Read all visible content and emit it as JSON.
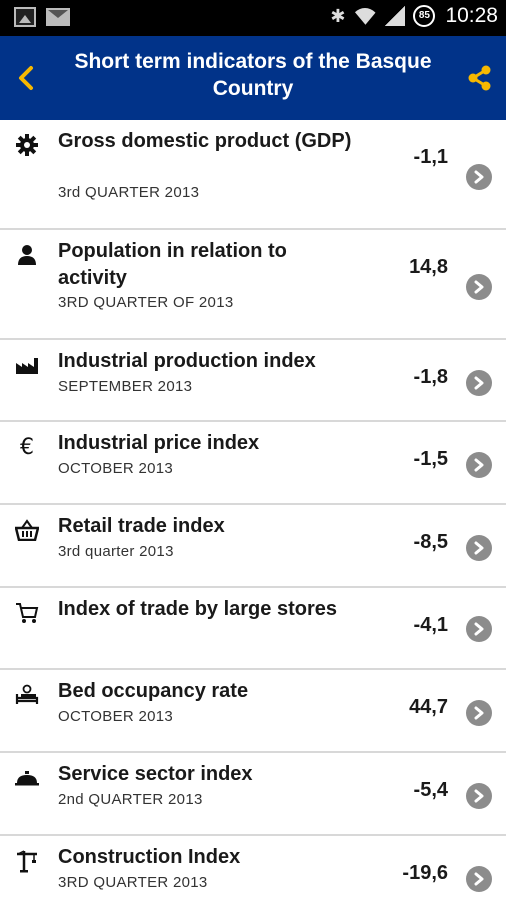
{
  "status_bar": {
    "time": "10:28",
    "battery_level": "85",
    "icons": [
      "gallery-icon",
      "email-icon",
      "bluetooth-icon",
      "wifi-icon",
      "signal-icon",
      "battery-icon"
    ]
  },
  "header": {
    "title": "Short term indicators of the Basque Country",
    "back_icon": "chevron-left-icon",
    "share_icon": "share-icon",
    "accent_color": "#f6b800",
    "background_color": "#013389"
  },
  "indicators": [
    {
      "icon": "gear-icon",
      "title": "Gross domestic product (GDP)",
      "period": "3rd QUARTER 2013",
      "value": "-1,1"
    },
    {
      "icon": "person-icon",
      "title": "Population in relation to activity",
      "period": "3RD QUARTER OF 2013",
      "value": "14,8"
    },
    {
      "icon": "factory-icon",
      "title": "Industrial production index",
      "period": "SEPTEMBER 2013",
      "value": "-1,8"
    },
    {
      "icon": "euro-icon",
      "title": "Industrial price index",
      "period": "OCTOBER 2013",
      "value": "-1,5"
    },
    {
      "icon": "basket-icon",
      "title": "Retail trade index",
      "period": "3rd quarter 2013",
      "value": "-8,5"
    },
    {
      "icon": "cart-icon",
      "title": "Index of trade by large stores",
      "period": "",
      "value": "-4,1"
    },
    {
      "icon": "bed-icon",
      "title": "Bed occupancy rate",
      "period": "OCTOBER 2013",
      "value": "44,7"
    },
    {
      "icon": "service-icon",
      "title": "Service sector index",
      "period": "2nd QUARTER 2013",
      "value": "-5,4"
    },
    {
      "icon": "crane-icon",
      "title": "Construction Index",
      "period": "3RD QUARTER 2013",
      "value": "-19,6"
    }
  ]
}
